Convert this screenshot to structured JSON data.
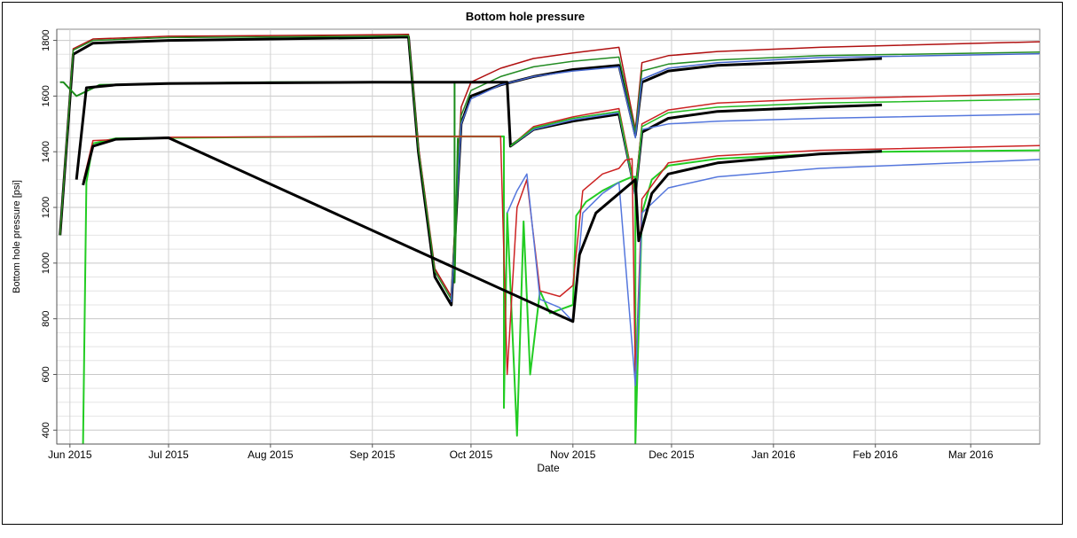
{
  "chart_data": {
    "type": "line",
    "title": "Bottom hole pressure",
    "xlabel": "Date",
    "ylabel": "Bottom hole pressure [psi]",
    "x_ticks": [
      "Jun 2015",
      "Jul 2015",
      "Aug 2015",
      "Sep 2015",
      "Oct 2015",
      "Nov 2015",
      "Dec 2015",
      "Jan 2016",
      "Feb 2016",
      "Mar 2016"
    ],
    "x_tick_dates": [
      "2015-06-01",
      "2015-07-01",
      "2015-08-01",
      "2015-09-01",
      "2015-10-01",
      "2015-11-01",
      "2015-12-01",
      "2016-01-01",
      "2016-02-01",
      "2016-03-01"
    ],
    "xlim": [
      "2015-05-28",
      "2016-03-22"
    ],
    "y_ticks": [
      400,
      600,
      800,
      1000,
      1200,
      1400,
      1600,
      1800
    ],
    "ylim": [
      350,
      1840
    ],
    "grid": true,
    "legend": "none",
    "series": [
      {
        "color": "#000000",
        "width": 3,
        "x": [
          "2015-05-29",
          "2015-06-02",
          "2015-06-08",
          "2015-07-01",
          "2015-09-01",
          "2015-09-12",
          "2015-09-15",
          "2015-09-20",
          "2015-09-25",
          "2015-09-28",
          "2015-10-01",
          "2015-10-10",
          "2015-10-20",
          "2015-11-01",
          "2015-11-15",
          "2015-11-20",
          "2015-11-22",
          "2015-11-30",
          "2015-12-15",
          "2016-01-15",
          "2016-02-03"
        ],
        "y": [
          1100,
          1750,
          1790,
          1800,
          1810,
          1812,
          1400,
          950,
          850,
          1500,
          1600,
          1640,
          1670,
          1695,
          1710,
          1460,
          1650,
          1690,
          1710,
          1725,
          1735
        ]
      },
      {
        "color": "#b01010",
        "width": 1.5,
        "x": [
          "2015-05-29",
          "2015-06-02",
          "2015-06-08",
          "2015-07-01",
          "2015-09-01",
          "2015-09-12",
          "2015-09-15",
          "2015-09-20",
          "2015-09-25",
          "2015-09-28",
          "2015-10-01",
          "2015-10-10",
          "2015-10-20",
          "2015-11-01",
          "2015-11-15",
          "2015-11-20",
          "2015-11-22",
          "2015-11-30",
          "2015-12-15",
          "2016-01-15",
          "2016-03-22"
        ],
        "y": [
          1100,
          1770,
          1805,
          1815,
          1820,
          1822,
          1420,
          980,
          880,
          1560,
          1650,
          1700,
          1735,
          1755,
          1775,
          1480,
          1720,
          1745,
          1760,
          1775,
          1795
        ]
      },
      {
        "color": "#228b22",
        "width": 1.5,
        "x": [
          "2015-05-29",
          "2015-06-02",
          "2015-06-08",
          "2015-07-01",
          "2015-09-01",
          "2015-09-12",
          "2015-09-15",
          "2015-09-20",
          "2015-09-25",
          "2015-09-28",
          "2015-10-01",
          "2015-10-10",
          "2015-10-20",
          "2015-11-01",
          "2015-11-15",
          "2015-11-20",
          "2015-11-22",
          "2015-11-30",
          "2015-12-15",
          "2016-01-15",
          "2016-03-22"
        ],
        "y": [
          1100,
          1765,
          1800,
          1810,
          1815,
          1817,
          1410,
          970,
          870,
          1530,
          1620,
          1670,
          1705,
          1725,
          1740,
          1470,
          1690,
          1715,
          1730,
          1745,
          1758
        ]
      },
      {
        "color": "#4466cc",
        "width": 1.5,
        "x": [
          "2015-09-25",
          "2015-09-28",
          "2015-10-01",
          "2015-10-10",
          "2015-10-20",
          "2015-11-01",
          "2015-11-15",
          "2015-11-20",
          "2015-11-22",
          "2015-11-30",
          "2015-12-15",
          "2016-01-15",
          "2016-03-22"
        ],
        "y": [
          860,
          1500,
          1590,
          1640,
          1670,
          1690,
          1705,
          1450,
          1660,
          1700,
          1720,
          1738,
          1752
        ]
      },
      {
        "color": "#1a8c1a",
        "width": 2,
        "x": [
          "2015-05-29",
          "2015-05-30",
          "2015-06-03",
          "2015-06-10",
          "2015-07-01",
          "2015-08-01",
          "2015-09-01",
          "2015-09-15",
          "2015-09-25",
          "2015-09-26",
          "2015-09-26",
          "2015-09-27"
        ],
        "y": [
          1650,
          1650,
          1600,
          1640,
          1645,
          1650,
          1650,
          1650,
          1650,
          1650,
          930,
          1450
        ]
      },
      {
        "color": "#000000",
        "width": 3,
        "x": [
          "2015-06-03",
          "2015-06-06",
          "2015-06-15",
          "2015-07-01",
          "2015-09-01",
          "2015-09-15",
          "2015-10-12",
          "2015-10-13",
          "2015-10-20",
          "2015-11-01",
          "2015-11-15",
          "2015-11-20",
          "2015-11-22",
          "2015-11-30",
          "2015-12-15",
          "2016-01-15",
          "2016-02-03"
        ],
        "y": [
          1300,
          1630,
          1640,
          1645,
          1650,
          1650,
          1650,
          1420,
          1480,
          1510,
          1535,
          1250,
          1470,
          1520,
          1545,
          1560,
          1568
        ]
      },
      {
        "color": "#cc2222",
        "width": 1.5,
        "x": [
          "2015-10-13",
          "2015-10-20",
          "2015-11-01",
          "2015-11-15",
          "2015-11-20",
          "2015-11-22",
          "2015-11-30",
          "2015-12-15",
          "2016-01-15",
          "2016-03-22"
        ],
        "y": [
          1420,
          1490,
          1525,
          1555,
          1260,
          1500,
          1550,
          1575,
          1590,
          1608
        ]
      },
      {
        "color": "#5577dd",
        "width": 1.5,
        "x": [
          "2015-10-13",
          "2015-10-20",
          "2015-11-01",
          "2015-11-15",
          "2015-11-20",
          "2015-11-22",
          "2015-11-30",
          "2015-12-15",
          "2016-01-15",
          "2016-03-22"
        ],
        "y": [
          1420,
          1480,
          1515,
          1540,
          1240,
          1480,
          1500,
          1510,
          1520,
          1535
        ]
      },
      {
        "color": "#22bb22",
        "width": 1.5,
        "x": [
          "2015-10-13",
          "2015-10-20",
          "2015-11-01",
          "2015-11-15",
          "2015-11-20",
          "2015-11-22",
          "2015-11-30",
          "2015-12-15",
          "2016-01-15",
          "2016-03-22"
        ],
        "y": [
          1420,
          1485,
          1520,
          1545,
          1250,
          1490,
          1540,
          1560,
          1575,
          1588
        ]
      },
      {
        "color": "#22cc22",
        "width": 2,
        "x": [
          "2015-06-05",
          "2015-06-06",
          "2015-06-08",
          "2015-06-15",
          "2015-07-01",
          "2015-08-01",
          "2015-09-01",
          "2015-10-01",
          "2015-10-10",
          "2015-10-11",
          "2015-10-11",
          "2015-10-12",
          "2015-10-15",
          "2015-10-17",
          "2015-10-19",
          "2015-10-22",
          "2015-10-25",
          "2015-11-01",
          "2015-11-02",
          "2015-11-05",
          "2015-11-10",
          "2015-11-15",
          "2015-11-17",
          "2015-11-19",
          "2015-11-20",
          "2015-11-20",
          "2015-11-22",
          "2015-11-25",
          "2015-11-30",
          "2015-12-15",
          "2016-01-15",
          "2016-02-03",
          "2016-03-22"
        ],
        "y": [
          350,
          1290,
          1430,
          1448,
          1450,
          1453,
          1455,
          1455,
          1455,
          1455,
          480,
          1180,
          380,
          1150,
          600,
          900,
          820,
          850,
          1170,
          1220,
          1260,
          1290,
          1300,
          1310,
          1310,
          350,
          1180,
          1300,
          1350,
          1375,
          1392,
          1400,
          1405
        ]
      },
      {
        "color": "#cc2222",
        "width": 1.5,
        "x": [
          "2015-06-05",
          "2015-06-08",
          "2015-07-01",
          "2015-09-01",
          "2015-09-15",
          "2015-10-10",
          "2015-10-12",
          "2015-10-15",
          "2015-10-18",
          "2015-10-22",
          "2015-10-28",
          "2015-11-01",
          "2015-11-04",
          "2015-11-10",
          "2015-11-15",
          "2015-11-17",
          "2015-11-19",
          "2015-11-20",
          "2015-11-22",
          "2015-11-30",
          "2015-12-15",
          "2016-01-15",
          "2016-03-22"
        ],
        "y": [
          1290,
          1440,
          1452,
          1455,
          1455,
          1455,
          600,
          1200,
          1300,
          900,
          880,
          920,
          1260,
          1320,
          1340,
          1370,
          1375,
          580,
          1230,
          1360,
          1385,
          1405,
          1422
        ]
      },
      {
        "color": "#5577dd",
        "width": 1.5,
        "x": [
          "2015-10-12",
          "2015-10-15",
          "2015-10-18",
          "2015-10-22",
          "2015-10-28",
          "2015-11-01",
          "2015-11-04",
          "2015-11-10",
          "2015-11-15",
          "2015-11-20",
          "2015-11-22",
          "2015-11-30",
          "2015-12-15",
          "2016-01-15",
          "2016-03-22"
        ],
        "y": [
          1180,
          1260,
          1320,
          870,
          840,
          790,
          1180,
          1250,
          1290,
          560,
          1180,
          1270,
          1310,
          1340,
          1372
        ]
      },
      {
        "color": "#000000",
        "width": 3,
        "x": [
          "2015-06-05",
          "2015-06-08",
          "2015-06-15",
          "2015-07-01",
          "2015-11-01",
          "2015-11-03",
          "2015-11-08",
          "2015-11-15",
          "2015-11-17",
          "2015-11-19",
          "2015-11-20",
          "2015-11-21",
          "2015-11-25",
          "2015-11-30",
          "2015-12-15",
          "2016-01-15",
          "2016-02-03"
        ],
        "y": [
          1280,
          1420,
          1445,
          1450,
          790,
          1030,
          1180,
          1250,
          1270,
          1290,
          1300,
          1080,
          1250,
          1320,
          1360,
          1392,
          1402
        ]
      }
    ]
  }
}
